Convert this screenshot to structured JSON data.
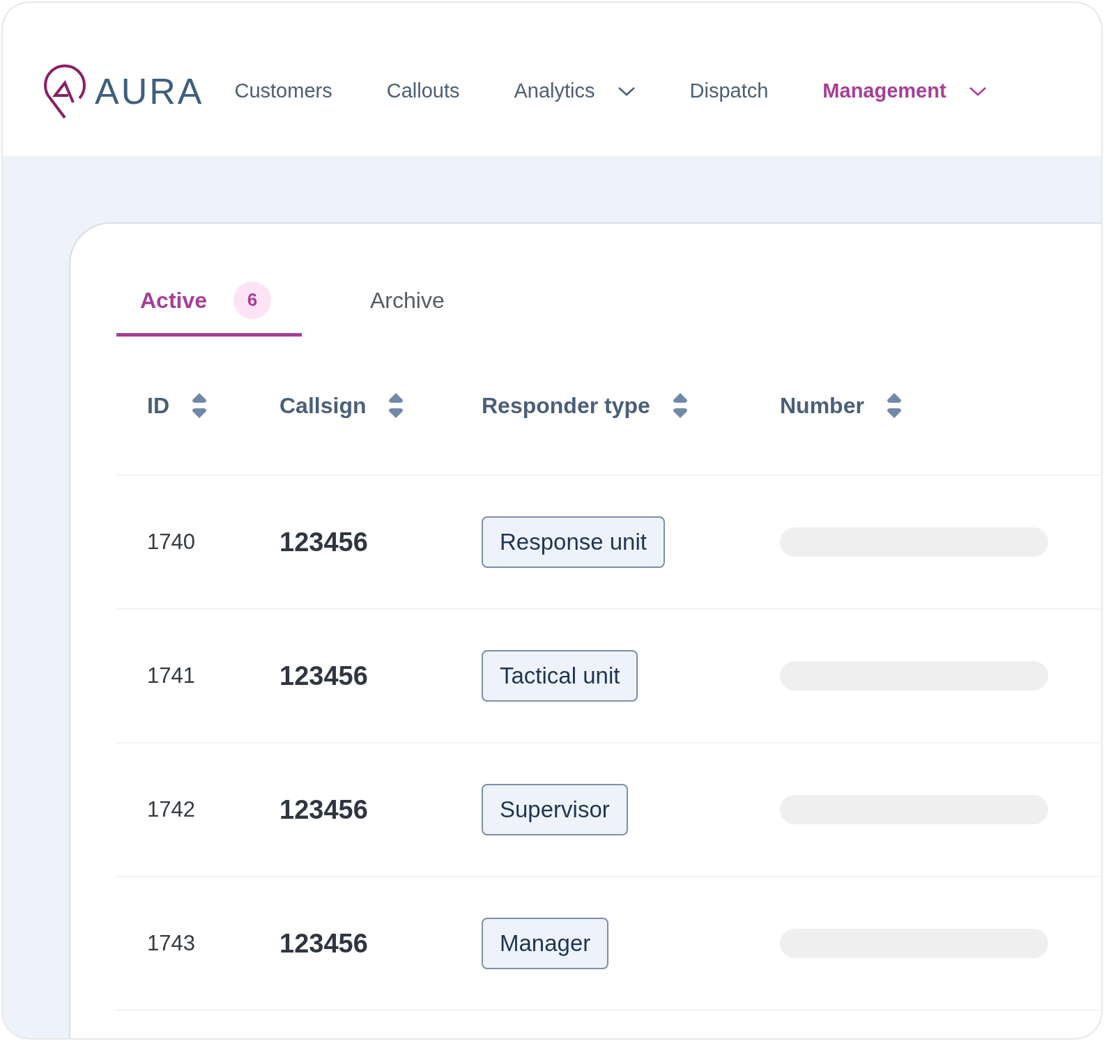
{
  "brand": {
    "name": "AURA"
  },
  "nav": [
    {
      "label": "Customers",
      "selected": false,
      "dropdown": false
    },
    {
      "label": "Callouts",
      "selected": false,
      "dropdown": false
    },
    {
      "label": "Analytics",
      "selected": false,
      "dropdown": true
    },
    {
      "label": "Dispatch",
      "selected": false,
      "dropdown": false
    },
    {
      "label": "Management",
      "selected": true,
      "dropdown": true
    }
  ],
  "tabs": [
    {
      "label": "Active",
      "selected": true,
      "count": "6"
    },
    {
      "label": "Archive",
      "selected": false
    }
  ],
  "table": {
    "columns": [
      "ID",
      "Callsign",
      "Responder type",
      "Number"
    ],
    "rows": [
      {
        "id": "1740",
        "callsign": "123456",
        "responder_type": "Response unit"
      },
      {
        "id": "1741",
        "callsign": "123456",
        "responder_type": "Tactical unit"
      },
      {
        "id": "1742",
        "callsign": "123456",
        "responder_type": "Supervisor"
      },
      {
        "id": "1743",
        "callsign": "123456",
        "responder_type": "Manager"
      }
    ]
  }
}
